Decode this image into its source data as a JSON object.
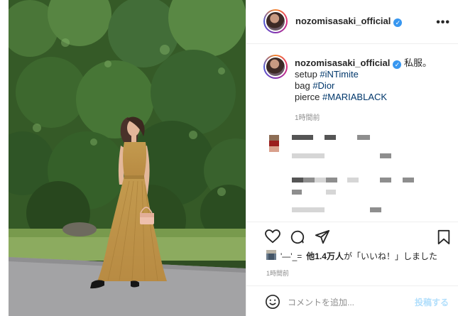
{
  "header": {
    "username": "nozomisasaki_official",
    "verified_mark": "✓",
    "more_label": "•••"
  },
  "caption": {
    "username": "nozomisasaki_official",
    "verified_mark": "✓",
    "text": "私服。",
    "lines": [
      {
        "prefix": "setup ",
        "tag": "#iNTimite"
      },
      {
        "prefix": "bag ",
        "tag": "#Dior"
      },
      {
        "prefix": "pierce ",
        "tag": "#MARIABLACK"
      }
    ],
    "time": "1時間前"
  },
  "likes": {
    "liker": "'—'_=",
    "count_text": "他1.4万人",
    "suffix": "が「いいね！」しました"
  },
  "post_time": "1時間前",
  "comment": {
    "placeholder": "コメントを追加...",
    "post_button": "投稿する",
    "emoji_icon": "smiley-face-icon"
  },
  "icons": {
    "like": "heart-icon",
    "comment": "comment-bubble-icon",
    "share": "paper-plane-icon",
    "save": "bookmark-icon",
    "more": "more-options-icon"
  },
  "colors": {
    "tag": "#00376b",
    "verified": "#3897f0",
    "post_button": "#b2dffc",
    "secondary_text": "#8e8e8e"
  }
}
